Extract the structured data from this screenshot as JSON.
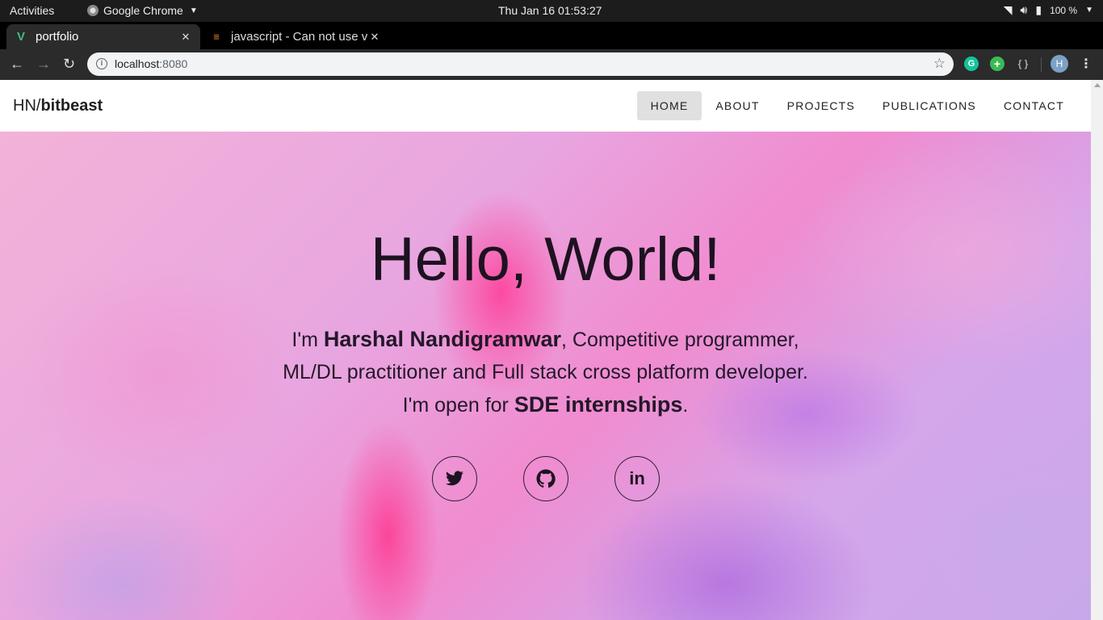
{
  "topbar": {
    "activities": "Activities",
    "app_name": "Google Chrome",
    "clock": "Thu Jan 16  01:53:27",
    "battery": "100 %"
  },
  "tabs": [
    {
      "title": "portfolio",
      "favicon": "vue-icon"
    },
    {
      "title": "javascript - Can not use v",
      "favicon": "stackoverflow-icon"
    }
  ],
  "omnibox": {
    "host": "localhost",
    "port": ":8080"
  },
  "profile_initial": "H",
  "site": {
    "brand_prefix": "HN/",
    "brand_name": "bitbeast",
    "nav": [
      "HOME",
      "ABOUT",
      "PROJECTS",
      "PUBLICATIONS",
      "CONTACT"
    ],
    "active_nav": "HOME"
  },
  "hero": {
    "heading": "Hello, World!",
    "line1_pre": "I'm ",
    "line1_name": "Harshal Nandigramwar",
    "line1_post": ", Competitive programmer,",
    "line2": "ML/DL practitioner and Full stack cross platform developer.",
    "line3_pre": "I'm open for ",
    "line3_bold": "SDE internships",
    "line3_post": ".",
    "socials": [
      "twitter-icon",
      "github-icon",
      "linkedin-icon"
    ],
    "linkedin_glyph": "in"
  }
}
